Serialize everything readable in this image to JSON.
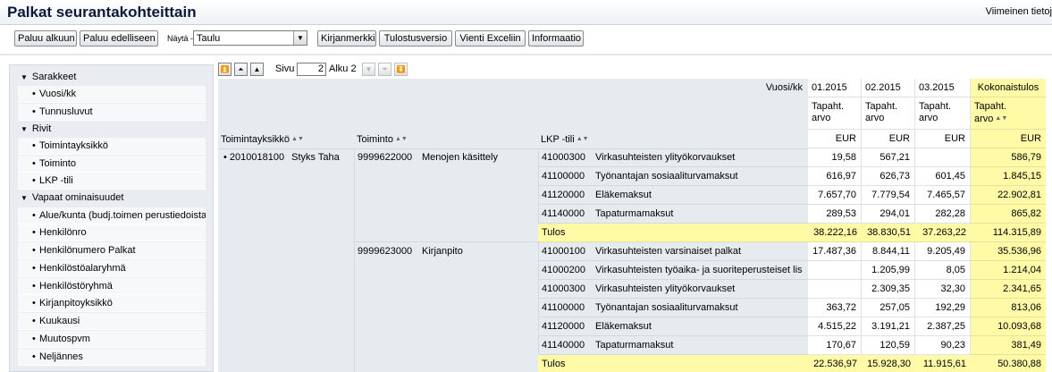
{
  "header": {
    "title": "Palkat seurantakohteittain",
    "last_data_label": "Viimeinen tietoj"
  },
  "toolbar": {
    "buttons": [
      "Paluu alkuun",
      "Paluu edelliseen",
      "Kirjanmerkki",
      "Tulostusversio",
      "Vienti Exceliin",
      "Informaatio"
    ],
    "nayta_label": "Näytä -",
    "view_select": "Taulu"
  },
  "navigation": {
    "sections": [
      {
        "label": "Sarakkeet",
        "items": [
          "Vuosi/kk",
          "Tunnusluvut"
        ]
      },
      {
        "label": "Rivit",
        "items": [
          "Toimintayksikkö",
          "Toiminto",
          "LKP -tili"
        ]
      },
      {
        "label": "Vapaat ominaisuudet",
        "items": [
          "Alue/kunta (budj.toimen perustiedoista)",
          "Henkilönro",
          "Henkilönumero Palkat",
          "Henkilöstöalaryhmä",
          "Henkilöstöryhmä",
          "Kirjanpitoyksikkö",
          "Kuukausi",
          "Muutospvm",
          "Neljännes"
        ]
      }
    ]
  },
  "pager": {
    "sivu_label": "Sivu",
    "page_value": "2",
    "alku_label": "Alku 2"
  },
  "table": {
    "vuosi_label": "Vuosi/kk",
    "periods": [
      "01.2015",
      "02.2015",
      "03.2015"
    ],
    "total_header": "Kokonaistulos",
    "measure": "Tapaht. arvo",
    "unit": "EUR",
    "row_headers": {
      "unit": "Toimintayksikkö",
      "function": "Toiminto",
      "account": "LKP -tili"
    },
    "unit_code": "2010018100",
    "unit_name": "Styks Taha",
    "groups": [
      {
        "function_code": "9999622000",
        "function_name": "Menojen käsittely",
        "rows": [
          {
            "account": "41000300",
            "name": "Virkasuhteisten ylityökorvaukset",
            "values": [
              "19,58",
              "567,21",
              ""
            ],
            "total": "586,79"
          },
          {
            "account": "41100000",
            "name": "Työnantajan sosiaaliturvamaksut",
            "values": [
              "616,97",
              "626,73",
              "601,45"
            ],
            "total": "1.845,15"
          },
          {
            "account": "41120000",
            "name": "Eläkemaksut",
            "values": [
              "7.657,70",
              "7.779,54",
              "7.465,57"
            ],
            "total": "22.902,81"
          },
          {
            "account": "41140000",
            "name": "Tapaturmamaksut",
            "values": [
              "289,53",
              "294,01",
              "282,28"
            ],
            "total": "865,82"
          }
        ],
        "result": {
          "label": "Tulos",
          "values": [
            "38.222,16",
            "38.830,51",
            "37.263,22"
          ],
          "total": "114.315,89"
        }
      },
      {
        "function_code": "9999623000",
        "function_name": "Kirjanpito",
        "rows": [
          {
            "account": "41000100",
            "name": "Virkasuhteisten varsinaiset palkat",
            "values": [
              "17.487,36",
              "8.844,11",
              "9.205,49"
            ],
            "total": "35.536,96"
          },
          {
            "account": "41000200",
            "name": "Virkasuhteisten työaika- ja suoriteperusteiset lis",
            "values": [
              "",
              "1.205,99",
              "8,05"
            ],
            "total": "1.214,04"
          },
          {
            "account": "41000300",
            "name": "Virkasuhteisten ylityökorvaukset",
            "values": [
              "",
              "2.309,35",
              "32,30"
            ],
            "total": "2.341,65"
          },
          {
            "account": "41100000",
            "name": "Työnantajan sosiaaliturvamaksut",
            "values": [
              "363,72",
              "257,05",
              "192,29"
            ],
            "total": "813,06"
          },
          {
            "account": "41120000",
            "name": "Eläkemaksut",
            "values": [
              "4.515,22",
              "3.191,21",
              "2.387,25"
            ],
            "total": "10.093,68"
          },
          {
            "account": "41140000",
            "name": "Tapaturmamaksut",
            "values": [
              "170,67",
              "120,59",
              "90,23"
            ],
            "total": "381,49"
          }
        ],
        "result": {
          "label": "Tulos",
          "values": [
            "22.536,97",
            "15.928,30",
            "11.915,61"
          ],
          "total": "50.380,88"
        }
      }
    ]
  },
  "colors": {
    "grid_bg": "#e6ebf0",
    "highlight": "#fffaa6",
    "nav_bg": "#e9edf2"
  }
}
